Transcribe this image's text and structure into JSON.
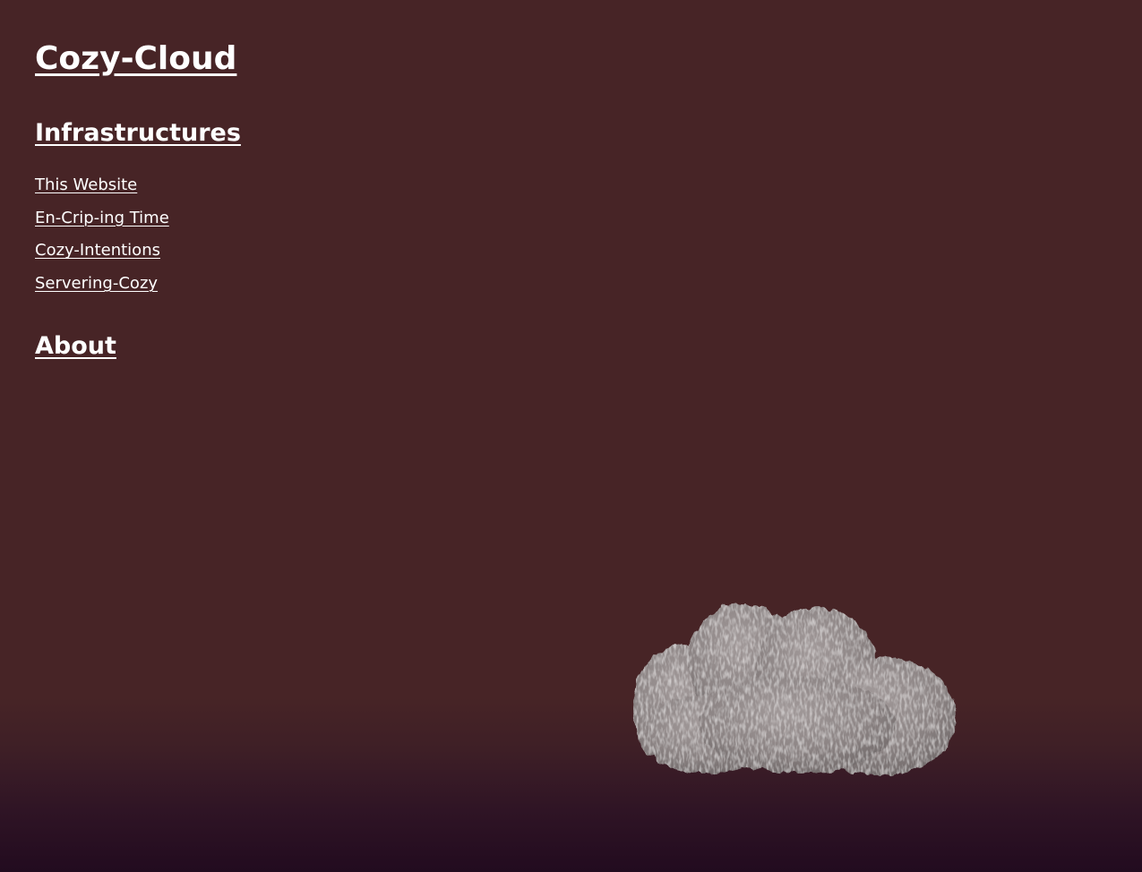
{
  "site": {
    "title": "Cozy-Cloud"
  },
  "nav": {
    "infrastructures_heading": "Infrastructures",
    "items": [
      {
        "label": "This Website"
      },
      {
        "label": "En-Crip-ing Time"
      },
      {
        "label": "Cozy-Intentions"
      },
      {
        "label": "Servering-Cozy"
      }
    ],
    "about_heading": "About"
  },
  "decoration": {
    "cloud_icon": "fluffy-cloud-icon",
    "background_color": "#472426",
    "background_bottom_color": "#220b1f",
    "cloud_color": "#8e8686"
  }
}
